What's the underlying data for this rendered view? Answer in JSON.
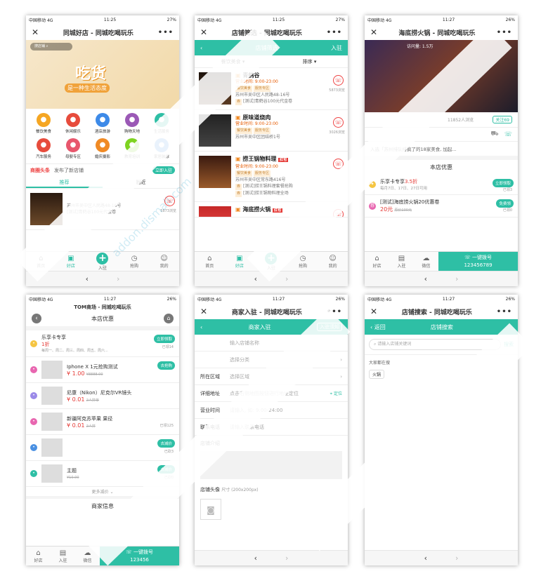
{
  "status": {
    "carrier": "中国移动",
    "net": "4G",
    "battery_27": "27%",
    "battery_26": "26%",
    "t1": "11:25",
    "t2": "11:27"
  },
  "p1": {
    "title": "同城好店 - 同城吃喝玩乐",
    "search_ph": "搜店铺",
    "banner_main": "吃货",
    "banner_sub": "是一种生活态度",
    "icons": [
      "餐饮美食",
      "休闲娱乐",
      "酒店旅游",
      "购物天地",
      "生活服务",
      "汽车服务",
      "母婴专区",
      "婚庆摄影",
      "教育培训",
      "家居装修"
    ],
    "headline_label": "商圈头条",
    "headline_text": "发布了新店铺",
    "enter_btn": "立即入驻",
    "tabs": [
      "推荐",
      "附近"
    ],
    "shop_addr": "苏州市吴中区人民路48-16号",
    "shop_coupon": "[测试]青鹤谷100元代金卷",
    "shop_views": "5873浏览"
  },
  "tabs5": [
    "首页",
    "好店",
    "入驻",
    "抢购",
    "我的"
  ],
  "p2": {
    "title": "店铺筛选 - 同城吃喝玩乐",
    "bar_center": "店铺筛选",
    "bar_right": "入驻",
    "filter1": "餐饮美食",
    "filter2": "排序",
    "shops": [
      {
        "name": "青鹤谷",
        "hours": "营业时间: 9:00-23:00",
        "tags": [
          "餐饮美食",
          "服务专区"
        ],
        "addr": "苏州市吴中区人民路48-16号",
        "coupon": "[测试]青鹤谷100元代金卷",
        "views": "5873浏览"
      },
      {
        "name": "原味道烧肉",
        "hours": "营业时间: 9:00-23:00",
        "tags": [
          "餐饮美食",
          "服务专区"
        ],
        "addr": "苏州市吴中区团结桥1号",
        "coupon": "",
        "views": "3026浏览"
      },
      {
        "name": "捞王锅物料理",
        "badge": "红包",
        "hours": "营业时间: 9:00-23:00",
        "tags": [
          "餐饮美食",
          "服务专区"
        ],
        "addr": "苏州市吴中区常东路416号",
        "coupon": "[测试]捞王锅料理套餐抢购",
        "coupon2": "[测试]捞王锅物料理全场",
        "views": ""
      },
      {
        "name": "海底捞火锅",
        "badge": "红包",
        "hours": "",
        "tags": [],
        "addr": "",
        "coupon": "",
        "views": ""
      }
    ]
  },
  "p3": {
    "title": "海底捞火锅 - 同城吃喝玩乐",
    "photo_meta": "访问量: 1.5万",
    "views": "11852人浏览",
    "follow": "关注69",
    "notice": "入选「苏州排队排疯了的18家美食, 加起...",
    "sec": "本店优惠",
    "c1_name": "乐享卡专享",
    "c1_val": "3.5折",
    "c1_sub": "每月7日、17日、27日可用",
    "c1_btn": "立即领取",
    "c1_left": "已领3",
    "c2_name": "[测试]海底捞火锅20优惠卷",
    "c2_price": "20元",
    "c2_old": "原价100元",
    "c2_btn": "免费领",
    "c2_left": "已领0",
    "bar": [
      "好店",
      "入驻",
      "微信"
    ],
    "call": "一键拨号",
    "phone": "123456789"
  },
  "p4": {
    "title": "TOM商场 - 同城吃喝玩乐",
    "sec": "本店优惠",
    "more": "更多减价",
    "sec2": "商家信息",
    "items": [
      {
        "name": "乐享卡专享",
        "val": "1折",
        "sub": "每周一、周二、周三、周四、周五、周六...",
        "btn": "立即领取",
        "left": "已领14"
      },
      {
        "name": "Iphone X 1元抢购测试",
        "price": "¥ 1.00",
        "old": "¥8888.00",
        "btn": "去抢购",
        "left": ""
      },
      {
        "name": "尼康（Nikon）尼克尔VR镜头",
        "price": "¥ 0.01",
        "old": "2人拼单",
        "btn": "",
        "left": ""
      },
      {
        "name": "新疆阿克苏苹果 果径",
        "price": "¥ 0.01",
        "old": "2人拼",
        "btn": "",
        "left": "已领125"
      },
      {
        "name": "",
        "price": "",
        "old": "",
        "btn": "去减价",
        "left": "已砍3"
      },
      {
        "name": "主题",
        "price": "",
        "old": "¥10.00",
        "btn": "去减价",
        "left": "已砍0"
      }
    ],
    "bar": [
      "好店",
      "入驻",
      "微信"
    ],
    "call": "一键拨号",
    "phone": "123456"
  },
  "p5": {
    "title": "商家入驻 - 同城吃喝玩乐",
    "bar_center": "商家入驻",
    "bar_right": "入驻须知",
    "fields": [
      {
        "l": "",
        "v": "输入店铺名称"
      },
      {
        "l": "",
        "v": "选择分类"
      },
      {
        "l": "所在区域",
        "v": "选择区域"
      },
      {
        "l": "详细地址",
        "v": "点击右侧地图按钮进行地址定位"
      },
      {
        "l": "营业时间",
        "v": "请输入, 如: 9:00-24:00"
      },
      {
        "l": "联系电话",
        "v": "请输入联系电话"
      }
    ],
    "locate": "定位",
    "intro": "店铺介绍",
    "avatar": "店铺头像",
    "avatar_size": "尺寸 (200x200px)"
  },
  "p6": {
    "title": "店铺搜索 - 同城吃喝玩乐",
    "back": "返回",
    "bar_center": "店铺搜索",
    "search_ph": "请输入店铺关键词",
    "search_btn": "搜索",
    "hot_label": "大家都在搜",
    "hot": [
      "火锅"
    ]
  },
  "watermark": "addon.dismall.com"
}
